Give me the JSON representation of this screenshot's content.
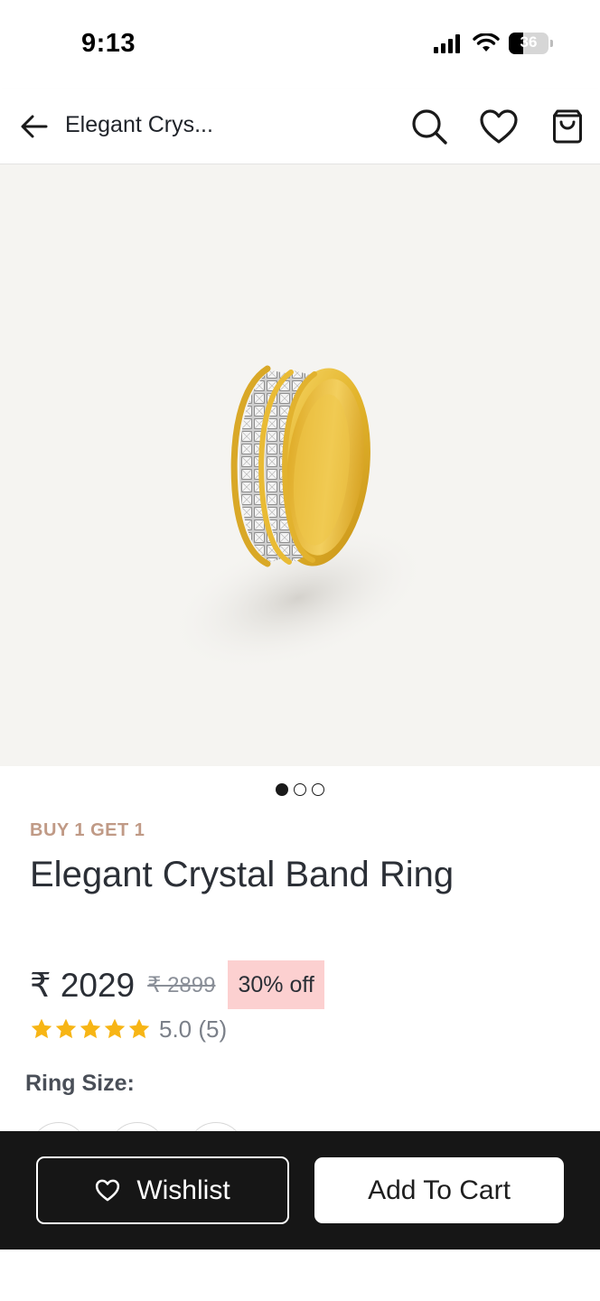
{
  "status_bar": {
    "time": "9:13",
    "battery_level": "36",
    "battery_fraction": 0.36,
    "signal_icon": "cellular-signal-icon",
    "wifi_icon": "wifi-icon"
  },
  "app_bar": {
    "title": "Elegant Crys...",
    "back_icon": "arrow-left-icon",
    "search_icon": "search-icon",
    "wishlist_icon": "heart-icon",
    "cart_icon": "shopping-bag-icon"
  },
  "gallery": {
    "image_count": 3,
    "active_index": 0,
    "background": "#f5f4f1"
  },
  "product": {
    "promo_label": "BUY 1 GET 1",
    "title": "Elegant Crystal Band Ring",
    "price": "₹ 2029",
    "mrp": "₹ 2899",
    "discount": "30% off",
    "rating_stars": 5,
    "rating_text": "5.0 (5)",
    "ring_size_label": "Ring Size:"
  },
  "actions": {
    "wishlist_label": "Wishlist",
    "add_to_cart_label": "Add To Cart"
  },
  "colors": {
    "promo": "#c09a86",
    "star": "#f7b515",
    "discount_bg": "#fcd0d0",
    "bottom_bar": "#161616"
  }
}
